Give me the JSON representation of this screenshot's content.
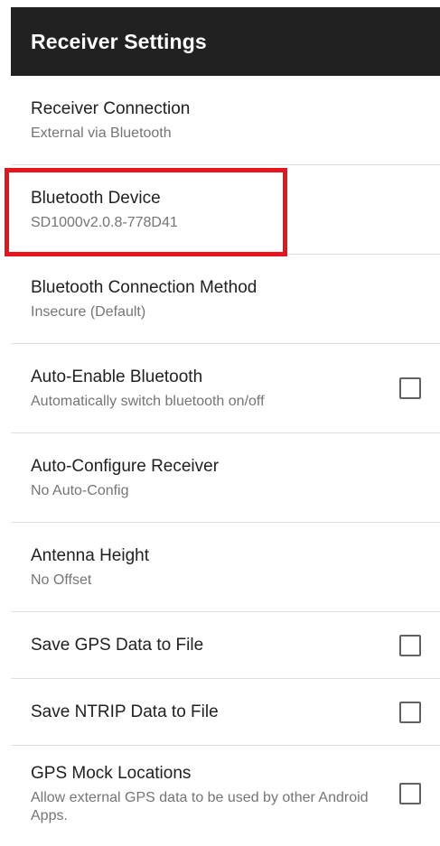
{
  "app_bar": {
    "title": "Receiver Settings"
  },
  "settings": {
    "items": [
      {
        "title": "Receiver Connection",
        "summary": "External via Bluetooth"
      },
      {
        "title": "Bluetooth Device",
        "summary": "SD1000v2.0.8-778D41"
      },
      {
        "title": "Bluetooth Connection Method",
        "summary": "Insecure (Default)"
      },
      {
        "title": "Auto-Enable Bluetooth",
        "summary": "Automatically switch bluetooth on/off",
        "checked": false
      },
      {
        "title": "Auto-Configure Receiver",
        "summary": "No Auto-Config"
      },
      {
        "title": "Antenna Height",
        "summary": "No Offset"
      },
      {
        "title": "Save GPS Data to File",
        "checked": false
      },
      {
        "title": "Save NTRIP Data to File",
        "checked": false
      },
      {
        "title": "GPS Mock Locations",
        "summary": "Allow external GPS data to be used by other Android Apps.",
        "checked": false
      }
    ]
  },
  "colors": {
    "app_bar": "#212121",
    "highlight": "#e8141b",
    "title_text": "#212121",
    "summary_text": "#757575",
    "divider": "#e0e0e0"
  }
}
